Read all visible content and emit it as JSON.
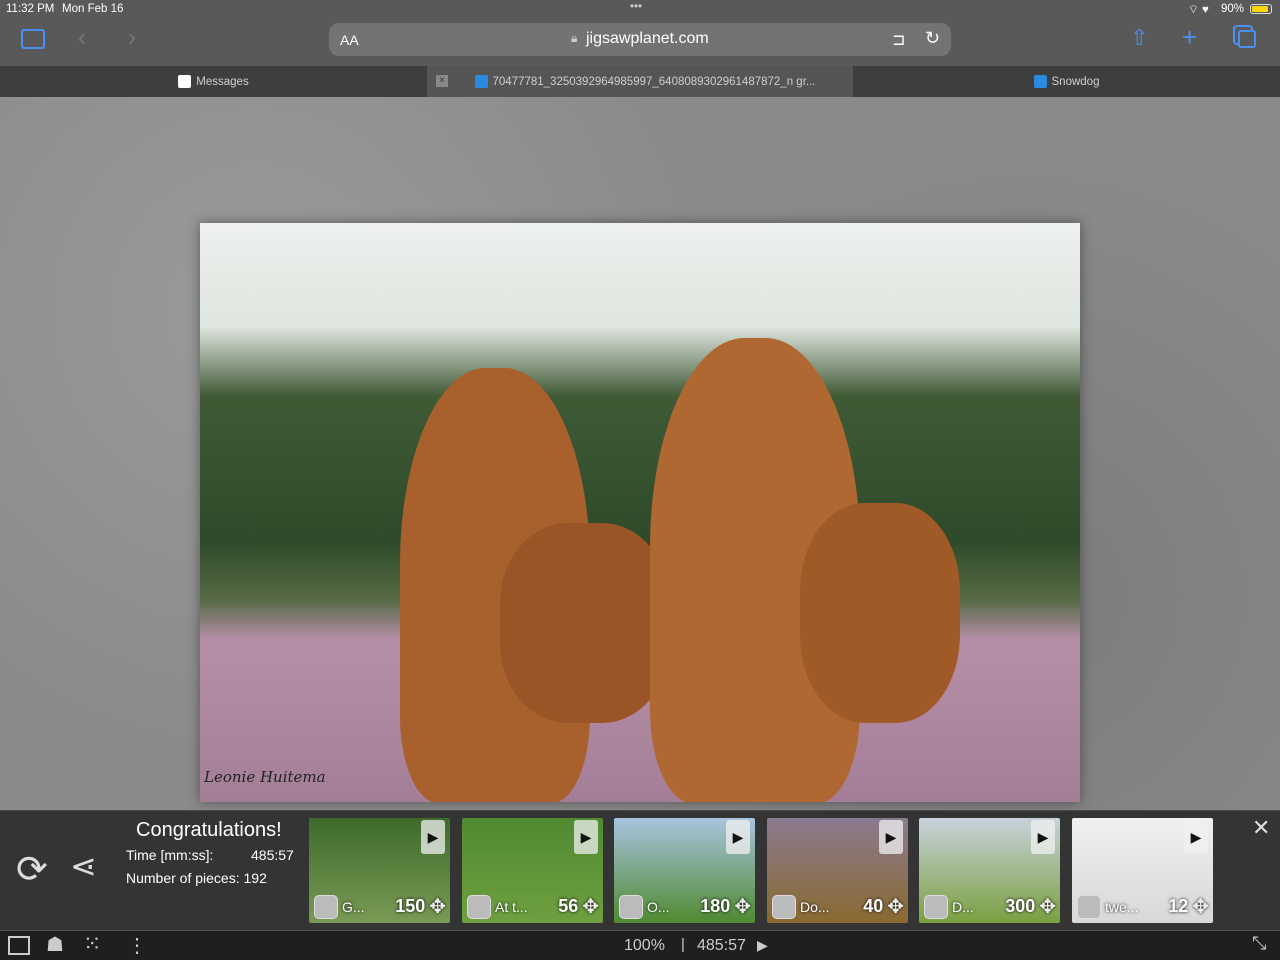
{
  "status": {
    "time": "11:32 PM",
    "date": "Mon Feb 16",
    "battery": "90%",
    "dots": "•••"
  },
  "toolbar": {
    "text_size": "AA",
    "url": "jigsawplanet.com"
  },
  "tabs": [
    {
      "label": "Messages"
    },
    {
      "label": "70477781_3250392964985997_6408089302961487872_n gr...",
      "active": true
    },
    {
      "label": "Snowdog"
    }
  ],
  "photo": {
    "signature": "Leonie Huitema"
  },
  "result": {
    "title": "Congratulations!",
    "time_label": "Time [mm:ss]:",
    "time_value": "485:57",
    "pieces_label": "Number of pieces: 192"
  },
  "suggestions": [
    {
      "author": "G...",
      "pieces": "150",
      "colors": [
        "#3d6a2a",
        "#7a9a55"
      ]
    },
    {
      "author": "At t...",
      "pieces": "56",
      "colors": [
        "#4f8a30",
        "#6ea040"
      ]
    },
    {
      "author": "O...",
      "pieces": "180",
      "colors": [
        "#a8c4e0",
        "#4f8a30"
      ]
    },
    {
      "author": "Do...",
      "pieces": "40",
      "colors": [
        "#8a7a90",
        "#8a6a30"
      ]
    },
    {
      "author": "D...",
      "pieces": "300",
      "colors": [
        "#c8d2dc",
        "#7aa040"
      ]
    },
    {
      "author": "twe...",
      "pieces": "12",
      "colors": [
        "#f0f0f0",
        "#d8d8d8"
      ]
    }
  ],
  "bottom": {
    "zoom": "100%",
    "separator": "|",
    "timer": "485:57"
  },
  "colors": {
    "accent": "#4a90f0",
    "battery": "#ffd60a"
  }
}
